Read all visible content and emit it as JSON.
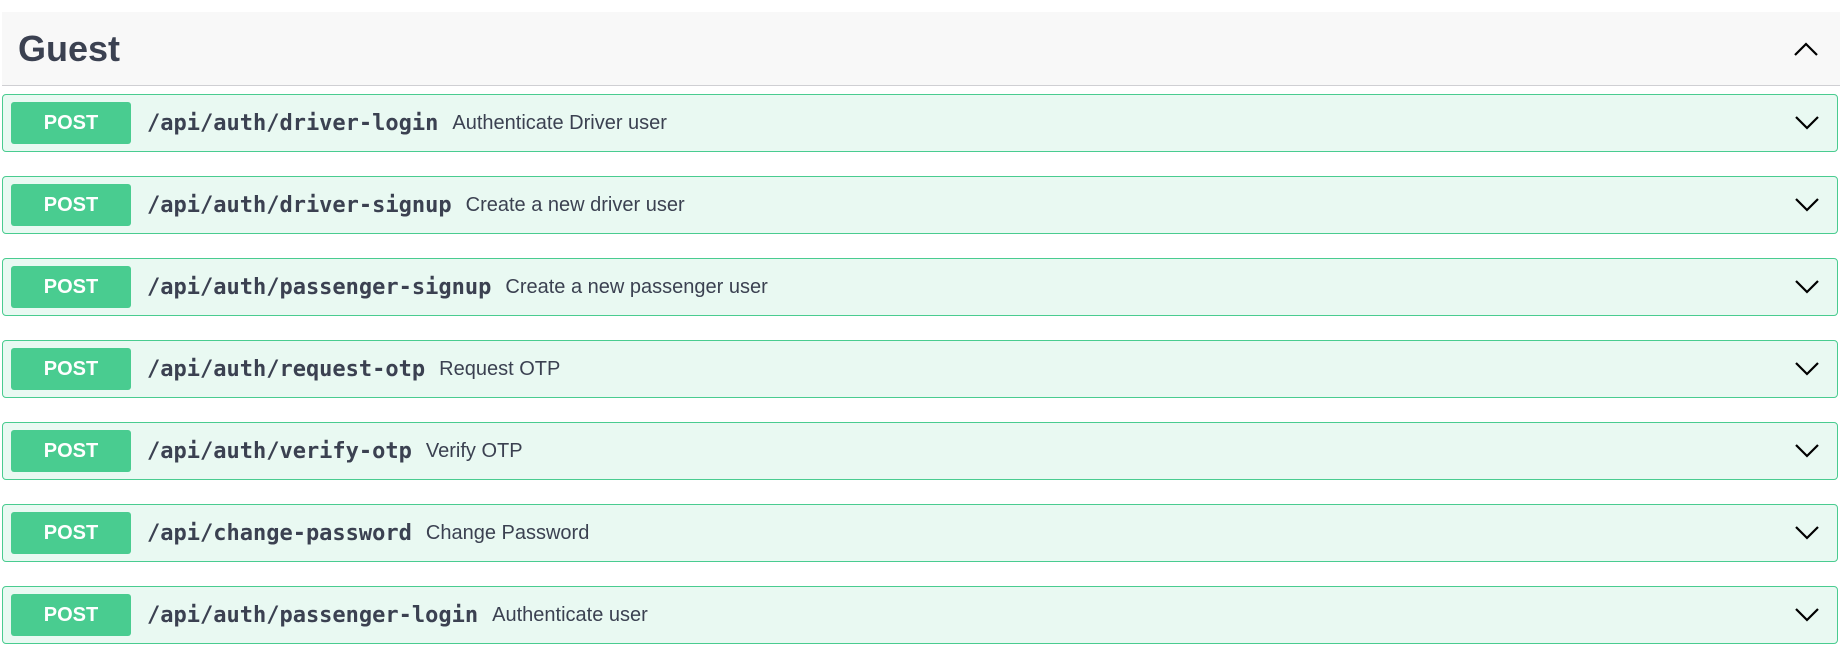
{
  "section": {
    "title": "Guest"
  },
  "operations": [
    {
      "method": "POST",
      "path": "/api/auth/driver-login",
      "summary": "Authenticate Driver user"
    },
    {
      "method": "POST",
      "path": "/api/auth/driver-signup",
      "summary": "Create a new driver user"
    },
    {
      "method": "POST",
      "path": "/api/auth/passenger-signup",
      "summary": "Create a new passenger user"
    },
    {
      "method": "POST",
      "path": "/api/auth/request-otp",
      "summary": "Request OTP"
    },
    {
      "method": "POST",
      "path": "/api/auth/verify-otp",
      "summary": "Verify OTP"
    },
    {
      "method": "POST",
      "path": "/api/change-password",
      "summary": "Change Password"
    },
    {
      "method": "POST",
      "path": "/api/auth/passenger-login",
      "summary": "Authenticate user"
    }
  ],
  "colors": {
    "post_accent": "#49cc90",
    "text": "#3b4151",
    "header_bg": "#f8f8f8"
  },
  "icons": {
    "section_toggle": "chevron-up-icon",
    "operation_toggle": "chevron-down-icon"
  }
}
